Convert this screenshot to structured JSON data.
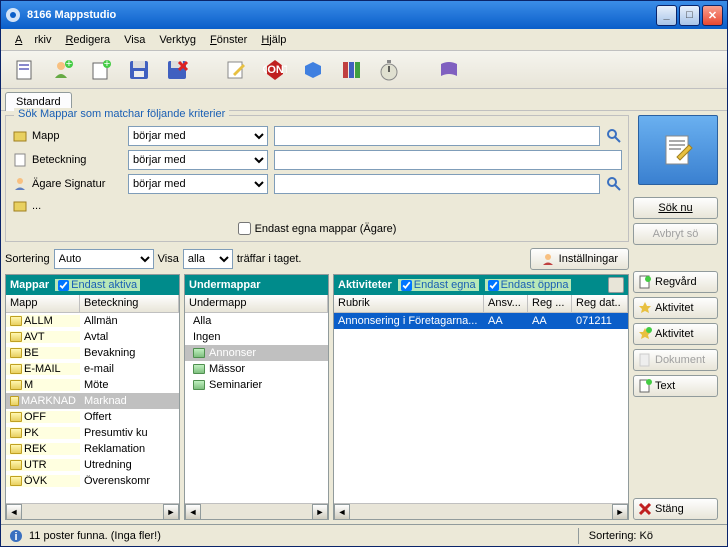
{
  "title": "8166 Mappstudio",
  "menu": {
    "arkiv": "Arkiv",
    "redigera": "Redigera",
    "visa": "Visa",
    "verktyg": "Verktyg",
    "fonster": "Fönster",
    "hjalp": "Hjälp"
  },
  "tab_standard": "Standard",
  "search": {
    "legend": "Sök  Mappar som matchar följande kriterier",
    "mapp": "Mapp",
    "beteckning": "Beteckning",
    "agare": "Ägare Signatur",
    "dots": "...",
    "op1": "börjar med",
    "op2": "börjar med",
    "op3": "börjar med",
    "v1": "",
    "v2": "",
    "v3": "",
    "endast_egna": "Endast egna mappar (Ägare)"
  },
  "sort": {
    "label": "Sortering",
    "value": "Auto",
    "visa": "Visa",
    "alla": "alla",
    "traffar": "träffar i taget.",
    "installningar": "Inställningar"
  },
  "mappar": {
    "title": "Mappar",
    "endast_aktiva": "Endast aktiva",
    "col_mapp": "Mapp",
    "col_bet": "Beteckning",
    "rows": [
      {
        "m": "ALLM",
        "b": "Allmän"
      },
      {
        "m": "AVT",
        "b": "Avtal"
      },
      {
        "m": "BE",
        "b": "Bevakning"
      },
      {
        "m": "E-MAIL",
        "b": "e-mail"
      },
      {
        "m": "M",
        "b": "Möte"
      },
      {
        "m": "MARKNAD",
        "b": "Marknad",
        "sel": true
      },
      {
        "m": "OFF",
        "b": "Offert"
      },
      {
        "m": "PK",
        "b": "Presumtiv ku"
      },
      {
        "m": "REK",
        "b": "Reklamation"
      },
      {
        "m": "UTR",
        "b": "Utredning"
      },
      {
        "m": "ÖVK",
        "b": "Överenskomr"
      }
    ]
  },
  "undermappar": {
    "title": "Undermappar",
    "col": "Undermapp",
    "rows": [
      {
        "n": "Alla"
      },
      {
        "n": "Ingen"
      },
      {
        "n": "Annonser",
        "sel": true,
        "ico": "g"
      },
      {
        "n": "Mässor",
        "ico": "g"
      },
      {
        "n": "Seminarier",
        "ico": "g"
      }
    ]
  },
  "aktiviteter": {
    "title": "Aktiviteter",
    "endast_egna": "Endast egna",
    "endast_oppna": "Endast öppna",
    "col_rubrik": "Rubrik",
    "col_ansv": "Ansv...",
    "col_reg": "Reg ...",
    "col_regdat": "Reg dat..",
    "rows": [
      {
        "r": "Annonsering i Företagarna...",
        "a": "AA",
        "g": "AA",
        "d": "071211"
      }
    ]
  },
  "side": {
    "sok_nu": "Sök nu",
    "avbryt": "Avbryt sö",
    "regvard": "Regvård",
    "aktivitet": "Aktivitet",
    "aktivitet2": "Aktivitet",
    "dokument": "Dokument",
    "text": "Text",
    "stang": "Stäng"
  },
  "status": {
    "msg": "11 poster funna.  (Inga fler!)",
    "sortering": "Sortering: Kö"
  }
}
